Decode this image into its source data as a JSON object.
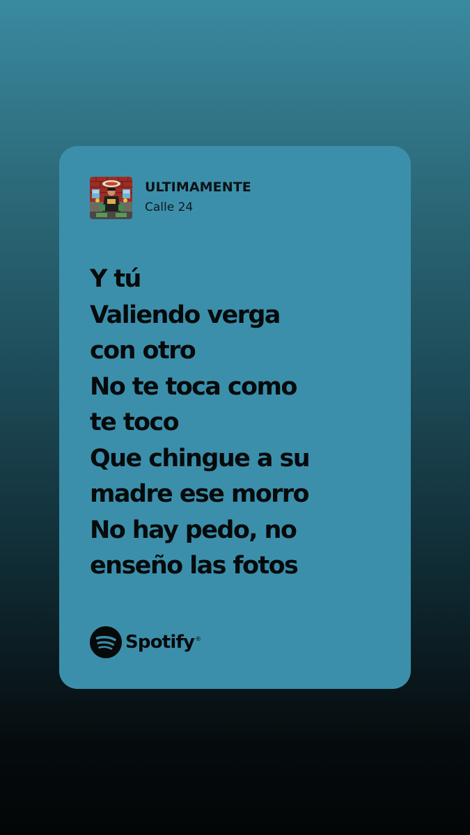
{
  "track": {
    "title": "ULTIMAMENTE",
    "artist": "Calle 24"
  },
  "lyrics": [
    "Y tú",
    "Valiendo verga",
    "con otro",
    "No te toca como",
    "te toco",
    "Que chingue a su",
    "madre ese morro",
    "No hay pedo, no",
    "enseño las fotos"
  ],
  "brand": {
    "name": "Spotify",
    "icon": "spotify-icon",
    "trademark": "®"
  },
  "colors": {
    "card_background": "#3c8fab",
    "text": "#060a0b",
    "page_top": "#3a8a9f",
    "page_bottom": "#030607"
  }
}
